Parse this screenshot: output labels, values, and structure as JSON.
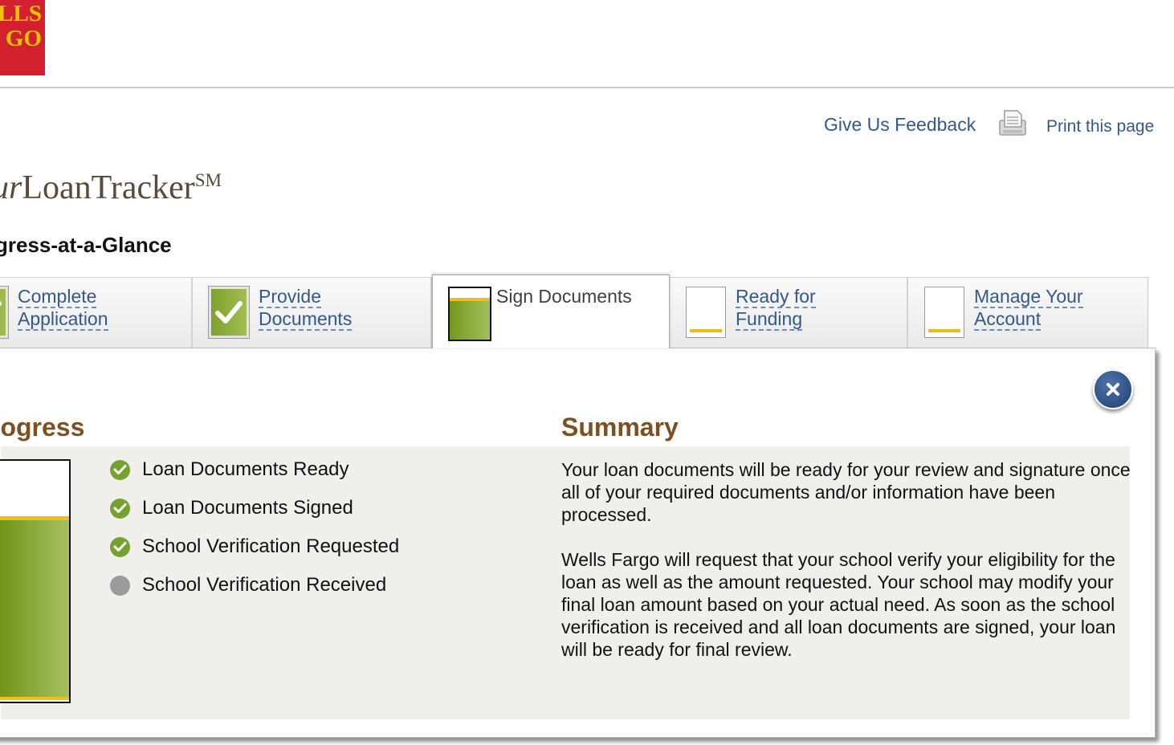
{
  "brand": {
    "logo_lines": [
      "LLS",
      "GO"
    ],
    "title_italic": "ur",
    "title_rest": "LoanTracker",
    "title_sup": "SM"
  },
  "header_links": {
    "feedback": "Give Us Feedback",
    "print_icon": "print-icon",
    "print": "Print this page"
  },
  "section_title": "gress-at-a-Glance",
  "tabs": [
    {
      "line1": "Complete",
      "line2": "Application",
      "state": "checked"
    },
    {
      "line1": "Provide",
      "line2": "Documents",
      "state": "checked"
    },
    {
      "line1": "Sign Documents",
      "line2": "",
      "state": "active"
    },
    {
      "line1": "Ready for",
      "line2": "Funding",
      "state": "empty"
    },
    {
      "line1": "Manage Your",
      "line2": "Account",
      "state": "empty"
    }
  ],
  "panel": {
    "close_icon": "close-icon",
    "progress_heading": "rogress",
    "summary_heading": "Summary",
    "steps": [
      {
        "label": "Loan Documents Ready",
        "status": "complete"
      },
      {
        "label": "Loan Documents Signed",
        "status": "complete"
      },
      {
        "label": "School Verification Requested",
        "status": "complete"
      },
      {
        "label": "School Verification Received",
        "status": "pending"
      }
    ],
    "summary_paragraphs": [
      "Your loan documents will be ready for your review and signature once all of your required documents and/or information have been processed.",
      "Wells Fargo will request that your school verify your eligibility for the loan as well as the amount requested. Your school may modify your final loan amount based on your actual need. As soon as the school verification is received and all loan documents are signed, your loan will be ready for final review."
    ]
  },
  "colors": {
    "logo_red": "#d2202f",
    "logo_gold": "#f4c400",
    "link_blue": "#33588a",
    "heading_brown": "#7c5020",
    "progress_green": "#74a22f",
    "progress_gold": "#e9c21a"
  }
}
